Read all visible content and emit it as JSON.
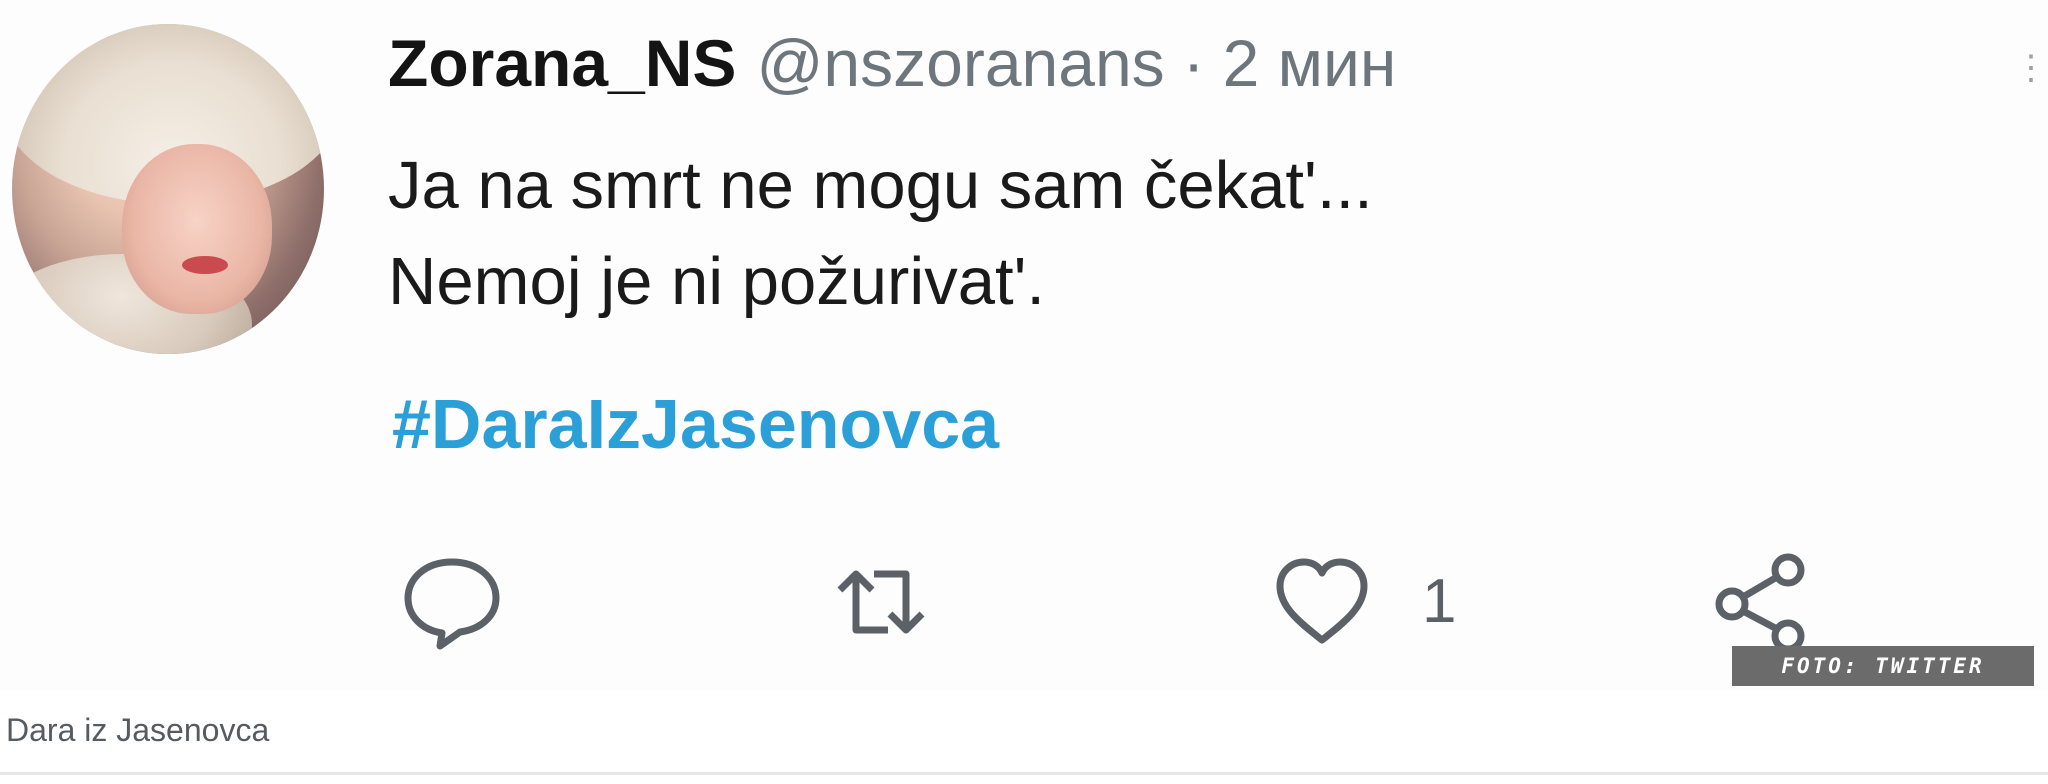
{
  "tweet": {
    "display_name": "Zorana_NS",
    "handle": "@nszoranans",
    "separator": "·",
    "time": "2 мин",
    "text_lines": [
      "Ja na smrt ne mogu sam čekat'...",
      "Nemoj je ni požurivat'."
    ],
    "hashtag": "#DaraIzJasenovca",
    "hashtag_color": "#2a9fd8",
    "actions": {
      "reply_icon": "reply-icon",
      "retweet_icon": "retweet-icon",
      "like_icon": "heart-icon",
      "like_count": "1",
      "share_icon": "share-icon"
    }
  },
  "photo_credit": "FOTO: TWITTER",
  "caption": "Dara iz Jasenovca"
}
